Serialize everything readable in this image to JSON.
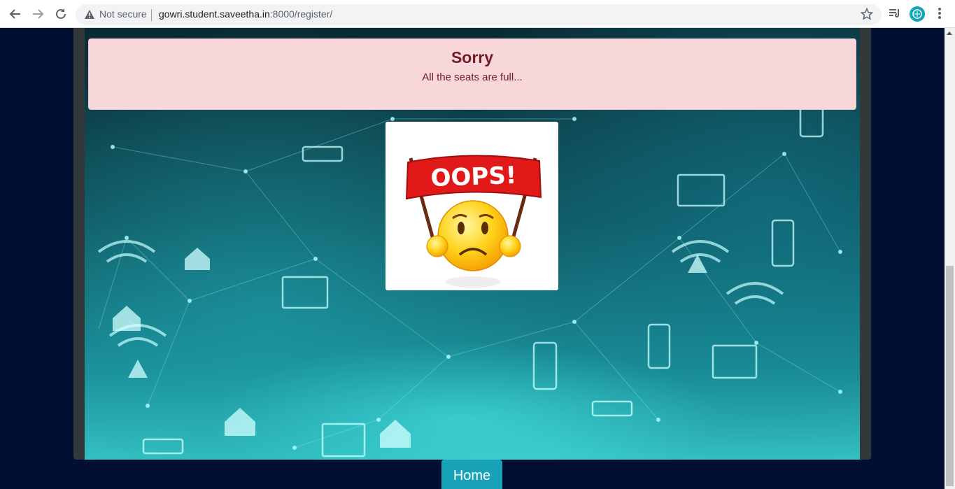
{
  "browser": {
    "security_label": "Not secure",
    "url_host": "gowri.student.saveetha.in",
    "url_path": ":8000/register/"
  },
  "alert": {
    "title": "Sorry",
    "message": "All the seats are full..."
  },
  "image": {
    "banner_text": "OOPS!"
  },
  "home_button": {
    "label": "Home"
  },
  "colors": {
    "alert_bg": "#f8d7da",
    "alert_text": "#721c24",
    "button": "#17a2b8",
    "page_bg": "#020f33"
  }
}
